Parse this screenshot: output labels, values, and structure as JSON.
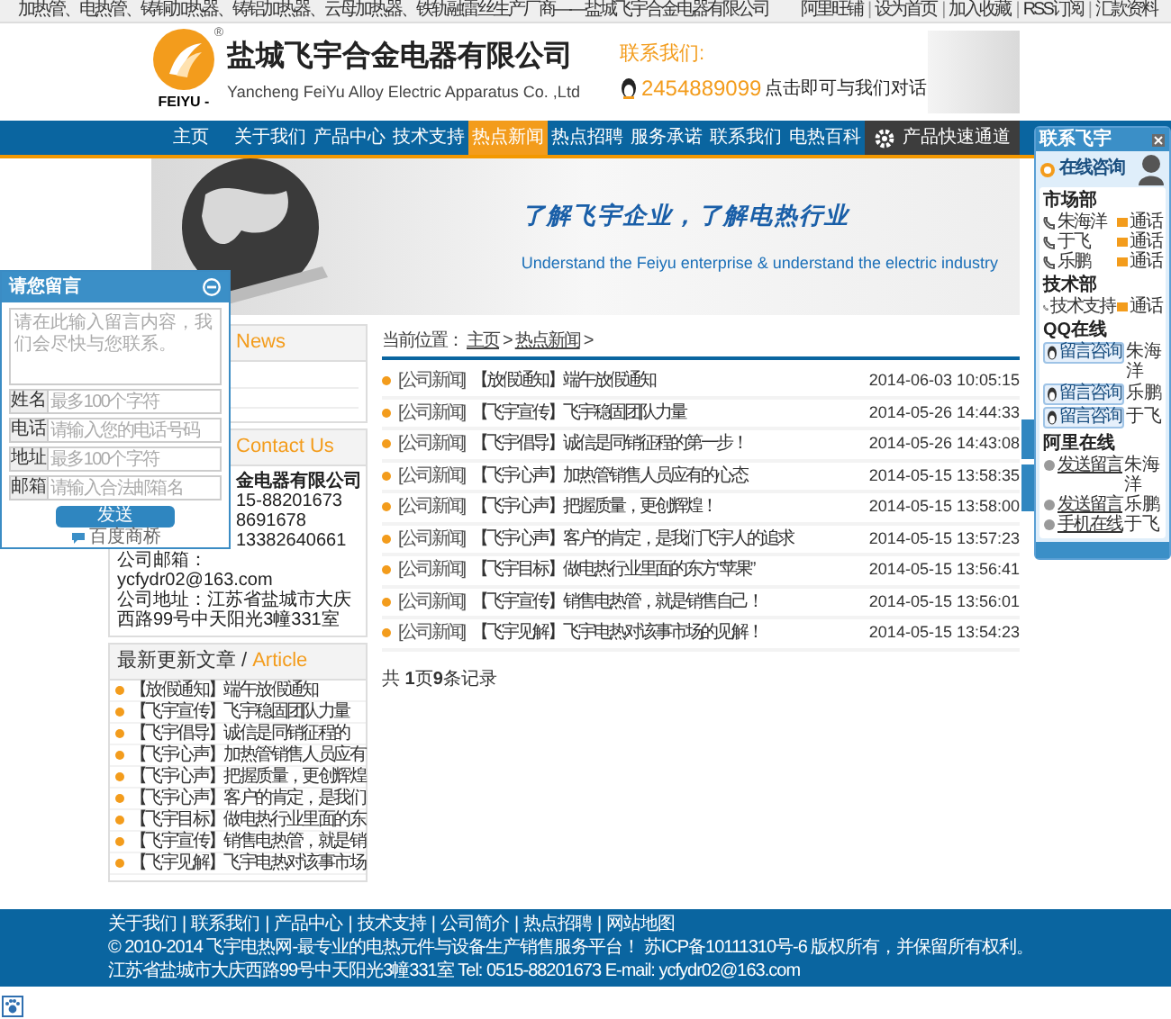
{
  "top_bar": {
    "slogan": "加热管、电热管、铸铜加热器、铸铝加热器、云母加热器、铁轨融雷丝生产厂商——盐城飞宇合金电器有限公司",
    "links": [
      "阿里旺铺",
      "设为首页",
      "加入收藏",
      "RSS订阅",
      "汇款资料"
    ],
    "separator": "|"
  },
  "header": {
    "logo_text": "FEIYU -",
    "registered_mark": "®",
    "company_name": "盐城飞宇合金电器有限公司",
    "company_name_en": "Yancheng FeiYu Alloy Electric Apparatus Co. ,Ltd",
    "contact_label": "联系我们:",
    "qq_number": "2454889099",
    "contact_hint": "点击即可与我们对话"
  },
  "nav": [
    {
      "label": "主页",
      "selected": false,
      "kind": "link"
    },
    {
      "label": "关于我们",
      "selected": false,
      "kind": "link"
    },
    {
      "label": "产品中心",
      "selected": false,
      "kind": "link"
    },
    {
      "label": "技术支持",
      "selected": false,
      "kind": "link"
    },
    {
      "label": "热点新闻",
      "selected": true,
      "kind": "link"
    },
    {
      "label": "热点招聘",
      "selected": false,
      "kind": "link"
    },
    {
      "label": "服务承诺",
      "selected": false,
      "kind": "link"
    },
    {
      "label": "联系我们",
      "selected": false,
      "kind": "link"
    },
    {
      "label": "电热百科",
      "selected": false,
      "kind": "link"
    },
    {
      "label": "产品快速通道",
      "selected": false,
      "kind": "quick"
    }
  ],
  "banner": {
    "slogan": "了解飞宇企业，了解电热行业",
    "slogan_en": "Understand the Feiyu enterprise & understand the electric industry"
  },
  "sidebar": {
    "news_box": {
      "title": "News"
    },
    "contact_box": {
      "title": "Contact Us",
      "lines": [
        {
          "text": "金电器有限公司",
          "kind": "company_partial"
        },
        {
          "text": "15-88201673",
          "kind": "partial"
        },
        {
          "text": "8691678",
          "kind": "partial"
        },
        {
          "text": "13382640661",
          "kind": "partial"
        },
        {
          "text": "公司邮箱：ycfydr02@163.com",
          "kind": "full"
        },
        {
          "text": "公司地址：江苏省盐城市大庆西路99号中天阳光3幢331室",
          "kind": "full"
        }
      ]
    },
    "article_box": {
      "title": "最新更新文章",
      "separator": "/",
      "title_en": "Article",
      "items": [
        "【放假通知】端午放假通知",
        "【飞宇宣传】飞宇稳固团队力量",
        "【飞宇倡导】诚信是同销征程的",
        "【飞宇心声】加热管销售人员应有",
        "【飞宇心声】把握质量，更创辉煌",
        "【飞宇心声】客户的肯定，是我们",
        "【飞宇目标】做电热行业里面的东",
        "【飞宇宣传】销售电热管，就是销",
        "【飞宇见解】飞宇电热对该事市场"
      ]
    }
  },
  "main": {
    "breadcrumb": {
      "prefix": "当前位置：",
      "links": [
        "主页",
        "热点新闻"
      ],
      "separator": ">"
    },
    "news": [
      {
        "category": "[公司新闻]",
        "title": "【放假通知】端午放假通知",
        "date": "2014-06-03 10:05:15"
      },
      {
        "category": "[公司新闻]",
        "title": "【飞宇宣传】飞宇稳固团队力量",
        "date": "2014-05-26 14:44:33"
      },
      {
        "category": "[公司新闻]",
        "title": "【飞宇倡导】诚信是同销征程的第一步！",
        "date": "2014-05-26 14:43:08"
      },
      {
        "category": "[公司新闻]",
        "title": "【飞宇心声】加热管销售人员应有的心态",
        "date": "2014-05-15 13:58:35"
      },
      {
        "category": "[公司新闻]",
        "title": "【飞宇心声】把握质量，更创辉煌！",
        "date": "2014-05-15 13:58:00"
      },
      {
        "category": "[公司新闻]",
        "title": "【飞宇心声】客户的肯定，是我们飞宇人的追求",
        "date": "2014-05-15 13:57:23"
      },
      {
        "category": "[公司新闻]",
        "title": "【飞宇目标】做电热行业里面的东方“苹果”",
        "date": "2014-05-15 13:56:41"
      },
      {
        "category": "[公司新闻]",
        "title": "【飞宇宣传】销售电热管，就是销售自己！",
        "date": "2014-05-15 13:56:01"
      },
      {
        "category": "[公司新闻]",
        "title": "【飞宇见解】飞宇电热对该事市场的见解！",
        "date": "2014-05-15 13:54:23"
      }
    ],
    "pagination": "共 **1**页**9**条记录"
  },
  "footer": {
    "links": [
      "关于我们",
      "联系我们",
      "产品中心",
      "技术支持",
      "公司简介",
      "热点招聘",
      "网站地图"
    ],
    "separator": "|",
    "copyright": "© 2010-2014 飞宇电热网-最专业的电热元件与设备生产销售服务平台！ 苏ICP备10111310号-6 版权所有，并保留所有权利。",
    "address": "江苏省盐城市大庆西路99号中天阳光3幢331室 Tel: 0515-88201673 E-mail: ycfydr02@163.com"
  },
  "message_box": {
    "title": "请您留言",
    "message_placeholder": "请在此输入留言内容，我们会尽快与您联系。",
    "fields": [
      {
        "label": "姓名",
        "placeholder": "最多100个字符"
      },
      {
        "label": "电话",
        "placeholder": "请输入您的电话号码"
      },
      {
        "label": "地址",
        "placeholder": "最多100个字符"
      },
      {
        "label": "邮箱",
        "placeholder": "请输入合法邮箱名"
      }
    ],
    "send_button": "发送",
    "footer": "百度商桥"
  },
  "contact_panel": {
    "title": "联系飞宇",
    "header": "在线咨询",
    "groups": [
      {
        "title": "市场部",
        "kind": "phone",
        "contacts": [
          {
            "name": "朱海洋",
            "action": "通话"
          },
          {
            "name": "于飞",
            "action": "通话"
          },
          {
            "name": "乐鹏",
            "action": "通话"
          }
        ]
      },
      {
        "title": "技术部",
        "kind": "phone",
        "contacts": [
          {
            "name": "技术支持",
            "action": "通话"
          }
        ]
      },
      {
        "title": "QQ在线",
        "kind": "qq",
        "contacts": [
          {
            "name": "朱海洋",
            "action": "留言咨询"
          },
          {
            "name": "乐鹏",
            "action": "留言咨询"
          },
          {
            "name": "于飞",
            "action": "留言咨询"
          }
        ]
      },
      {
        "title": "阿里在线",
        "kind": "ali",
        "contacts": [
          {
            "name": "朱海洋",
            "action": "发送留言"
          },
          {
            "name": "乐鹏",
            "action": "发送留言"
          },
          {
            "name": "于飞",
            "action": "手机在线"
          }
        ]
      }
    ]
  }
}
